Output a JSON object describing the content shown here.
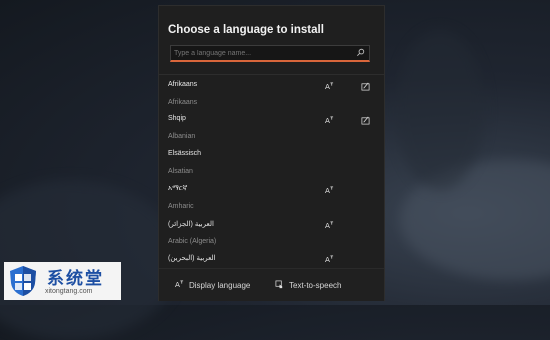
{
  "dialog": {
    "title": "Choose a language to install",
    "search": {
      "placeholder": "Type a language name...",
      "value": ""
    }
  },
  "languages": [
    {
      "native": "Afrikaans",
      "english": "Afrikaans",
      "icons": [
        "display-language-icon",
        "handwriting-icon"
      ]
    },
    {
      "native": "Shqip",
      "english": "Albanian",
      "icons": [
        "display-language-icon",
        "handwriting-icon"
      ]
    },
    {
      "native": "Elsässisch",
      "english": "Alsatian",
      "icons": []
    },
    {
      "native": "አማርኛ",
      "english": "Amharic",
      "icons": [
        "display-language-icon"
      ]
    },
    {
      "native": "العربية (الجزائر)",
      "english": "Arabic (Algeria)",
      "icons": [
        "display-language-icon"
      ]
    },
    {
      "native": "العربية (البحرين)",
      "english": "",
      "icons": [
        "display-language-icon"
      ]
    }
  ],
  "footer": {
    "display_language": "Display language",
    "text_to_speech": "Text-to-speech"
  },
  "watermark": {
    "brand": "系统堂",
    "url": "xitongtang.com"
  },
  "colors": {
    "accent": "#d9663b",
    "dialog_bg": "#1f1f1f",
    "watermark_blue": "#1d4fa3"
  }
}
